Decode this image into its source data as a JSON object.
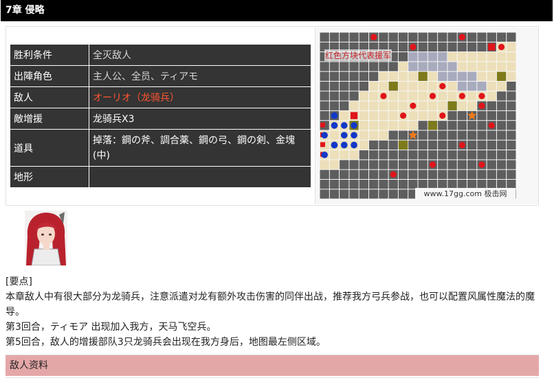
{
  "header": {
    "title": "7章 侵略"
  },
  "info_table": [
    {
      "key": "胜利条件",
      "value": "全灭敌人",
      "style": "normal"
    },
    {
      "key": "出陣角色",
      "value": "主人公、全员、ティアモ",
      "style": "normal"
    },
    {
      "key": "敌人",
      "value": "オーリオ（龙骑兵）",
      "style": "red"
    },
    {
      "key": "敵增援",
      "value": "龙骑兵X3",
      "style": "white"
    },
    {
      "key": "道具",
      "value": "掉落：鋼の斧、調合薬、鋼の弓、鋼の剣、金塊(中)",
      "style": "white"
    },
    {
      "key": "地形",
      "value": "",
      "style": "normal"
    }
  ],
  "map": {
    "label": "红色方块代表援军",
    "watermark": "www.17gg.com 极击网",
    "colors": {
      "sand": "#ecdfb9",
      "rock": "#5e5e5e",
      "cliff": "#a8abbd",
      "bush": "#7d7a1b",
      "red": "#e0141a",
      "blue": "#1238c8",
      "star": "#f07a1a"
    }
  },
  "portrait": {
    "icon": "red-haired-character-portrait"
  },
  "notes": {
    "heading": "[要点]",
    "lines": [
      "本章敌人中有很大部分为龙骑兵，注意派遣对龙有额外攻击伤害的同伴出战，推荐我方弓兵参战，也可以配置风属性魔法的魔导。",
      "第3回合，ティモア 出现加入我方，天马飞空兵。",
      "第5回合，敌人的增援部队3只龙骑兵会出现在我方身后，地图最左侧区域。"
    ]
  },
  "section": {
    "title": "敌人资料"
  }
}
